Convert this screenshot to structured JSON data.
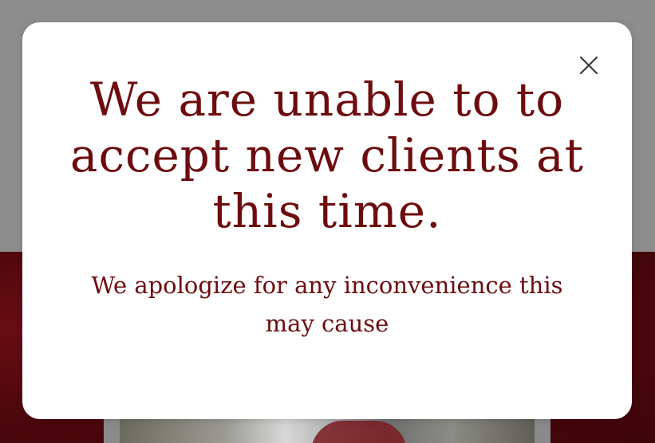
{
  "modal": {
    "title": "We are unable to to accept new clients at this time.",
    "message": "We apologize for any inconvenience this may cause",
    "close_icon": "close-icon"
  },
  "colors": {
    "title_text": "#6d0c0f",
    "overlay_grey": "#8d8d8d",
    "background_red": "#4d070c",
    "modal_bg": "#ffffff"
  }
}
